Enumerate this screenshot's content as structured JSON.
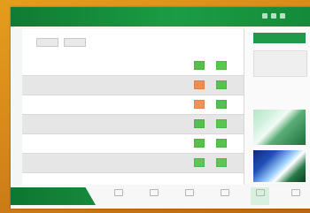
{
  "window": {
    "title": ""
  },
  "filters": [
    "",
    ""
  ],
  "rows": [
    {
      "id": "",
      "text": "",
      "meta": "",
      "status_a": "#55c04e",
      "status_b": "#59c84f"
    },
    {
      "id": "",
      "text": "",
      "meta": "",
      "status_a": "#f18d4e",
      "status_b": "#56c252"
    },
    {
      "id": "",
      "text": "",
      "meta": "",
      "status_a": "#f29355",
      "status_b": "#55c052"
    },
    {
      "id": "",
      "text": "",
      "meta": "",
      "status_a": "#55c04e",
      "status_b": "#58c64f"
    },
    {
      "id": "",
      "text": "",
      "meta": "",
      "status_a": "#56c14f",
      "status_b": "#57c250"
    },
    {
      "id": "",
      "text": "",
      "meta": "",
      "status_a": "#5bc558",
      "status_b": "#5bc558"
    }
  ],
  "side": {
    "title": "",
    "card_label": "",
    "card_value": "",
    "caption": ""
  },
  "footer": {
    "label": "",
    "nav": [
      "",
      "",
      "",
      "",
      "",
      ""
    ]
  },
  "colors": {
    "bezel": "#d6871a",
    "header": "#1b9d43",
    "badge_green": "#55c04e",
    "badge_orange": "#f18d4e"
  }
}
